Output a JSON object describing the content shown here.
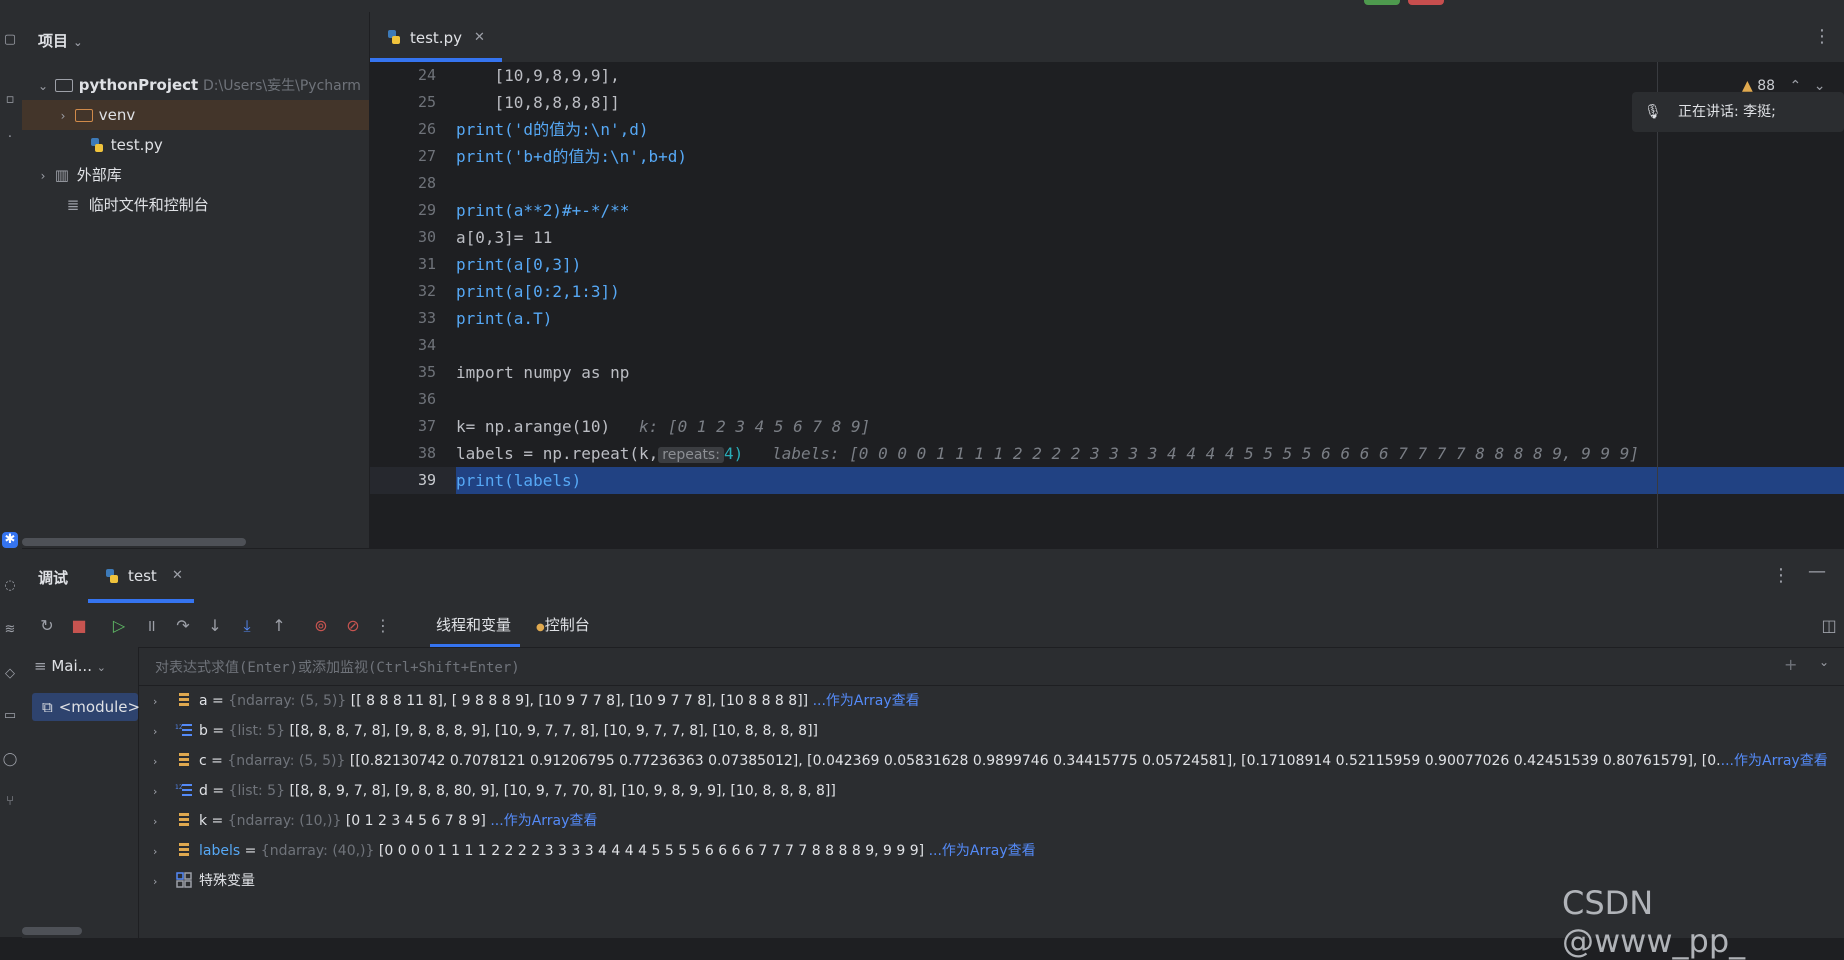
{
  "project_panel": {
    "title": "项目",
    "tree": [
      {
        "label": "pythonProject",
        "path": "D:\\Users\\妄生\\Pycharm"
      },
      {
        "label": "venv"
      },
      {
        "label": "test.py"
      },
      {
        "label": "外部库"
      },
      {
        "label": "临时文件和控制台"
      }
    ]
  },
  "editor": {
    "tab_label": "test.py",
    "warnings": "88",
    "speaking_label": "正在讲话: 李挺;",
    "line_numbers": [
      "24",
      "25",
      "26",
      "27",
      "28",
      "29",
      "30",
      "31",
      "32",
      "33",
      "34",
      "35",
      "36",
      "37",
      "38",
      "39"
    ],
    "lines": [
      "    [10,9,8,9,9],",
      "    [10,8,8,8,8]]",
      "print('d的值为:\\n',d)",
      "print('b+d的值为:\\n',b+d)",
      "",
      "print(a**2)#+-*/**",
      "a[0,3]= 11",
      "print(a[0,3])",
      "print(a[0:2,1:3])",
      "print(a.T)",
      "",
      "import numpy as np",
      "",
      "k= np.arange(10)",
      "labels = np.repeat(k,",
      "print(labels)"
    ],
    "hint_k": "k: [0 1 2 3 4 5 6 7 8 9]",
    "inlay_repeats": "repeats:",
    "repeat_tail": "4)",
    "hint_labels": "labels: [0 0 0 0 1 1 1 1 2 2 2 2 3 3 3 3 4 4 4 4 5 5 5 5 6 6 6 6 7 7 7 7 8 8 8 8 9, 9 9 9]"
  },
  "debug": {
    "title": "调试",
    "tab_label": "test",
    "subtab_threads": "线程和变量",
    "subtab_console": "控制台",
    "frames_head": "Mai...",
    "frame_selected": "<module>",
    "eval_placeholder": "对表达式求值(Enter)或添加监视(Ctrl+Shift+Enter)",
    "variables": [
      {
        "name": "a",
        "type": "{ndarray: (5, 5)}",
        "value": "[[ 8  8  8 11  8], [ 9  8  8  8  9], [10  9  7  7  8], [10  9  7  7  8], [10  8  8  8  8]]",
        "link": "...作为Array查看",
        "icon": "array-icon"
      },
      {
        "name": "b",
        "type": "{list: 5}",
        "value": "[[8, 8, 8, 7, 8], [9, 8, 8, 8, 9], [10, 9, 7, 7, 8], [10, 9, 7, 7, 8], [10, 8, 8, 8, 8]]",
        "link": "",
        "icon": "list-icon"
      },
      {
        "name": "c",
        "type": "{ndarray: (5, 5)}",
        "value": "[[0.82130742 0.7078121  0.91206795 0.77236363 0.07385012], [0.042369   0.05831628 0.9899746  0.34415775 0.05724581], [0.17108914 0.52115959 0.90077026 0.42451539 0.80761579], [0.",
        "link": "...作为Array查看",
        "icon": "array-icon"
      },
      {
        "name": "d",
        "type": "{list: 5}",
        "value": "[[8, 8, 9, 7, 8], [9, 8, 8, 80, 9], [10, 9, 7, 70, 8], [10, 9, 8, 9, 9], [10, 8, 8, 8, 8]]",
        "link": "",
        "icon": "list-icon"
      },
      {
        "name": "k",
        "type": "{ndarray: (10,)}",
        "value": "[0 1 2 3 4 5 6 7 8 9]",
        "link": "...作为Array查看",
        "icon": "array-icon"
      },
      {
        "name": "labels",
        "type": "{ndarray: (40,)}",
        "value": "[0 0 0 0 1 1 1 1 2 2 2 2 3 3 3 3 4 4 4 4 5 5 5 5 6 6 6 6 7 7 7 7 8 8 8 8 9, 9 9 9]",
        "link": "...作为Array查看",
        "icon": "array-icon"
      },
      {
        "name": "特殊变量",
        "type": "",
        "value": "",
        "link": "",
        "icon": "special-vars-icon"
      }
    ]
  },
  "watermark": "CSDN @www_pp_"
}
